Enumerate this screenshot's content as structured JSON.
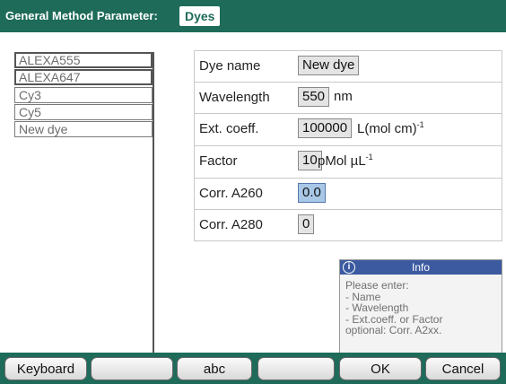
{
  "header": {
    "title": "General Method Parameter:",
    "tab": "Dyes"
  },
  "dyes": [
    "ALEXA555",
    "ALEXA647",
    "Cy3",
    "Cy5",
    "New dye"
  ],
  "params": {
    "dye_name": {
      "label": "Dye name",
      "value": "New dye"
    },
    "wavelength": {
      "label": "Wavelength",
      "value": "550",
      "unit": "nm"
    },
    "ext_coeff": {
      "label": "Ext. coeff.",
      "value": "100000",
      "unit": "L(mol cm)",
      "unit_sup": "-1"
    },
    "factor": {
      "label": "Factor",
      "value": "10",
      "unit": "pMol µL",
      "unit_sup": "-1"
    },
    "corr_a260": {
      "label": "Corr. A260",
      "value": "0.0"
    },
    "corr_a280": {
      "label": "Corr. A280",
      "value": "0"
    }
  },
  "info": {
    "title": "Info",
    "lines": [
      "Please enter:",
      "-  Name",
      "-  Wavelength",
      "-  Ext.coeff. or Factor",
      "optional: Corr. A2xx."
    ]
  },
  "buttons": {
    "keyboard": "Keyboard",
    "blank1": "",
    "abc": "abc",
    "blank2": "",
    "ok": "OK",
    "cancel": "Cancel"
  },
  "colors": {
    "header_bg": "#1e6b5a",
    "info_header": "#3c5aa0",
    "selected_field": "#a9c8e8"
  }
}
